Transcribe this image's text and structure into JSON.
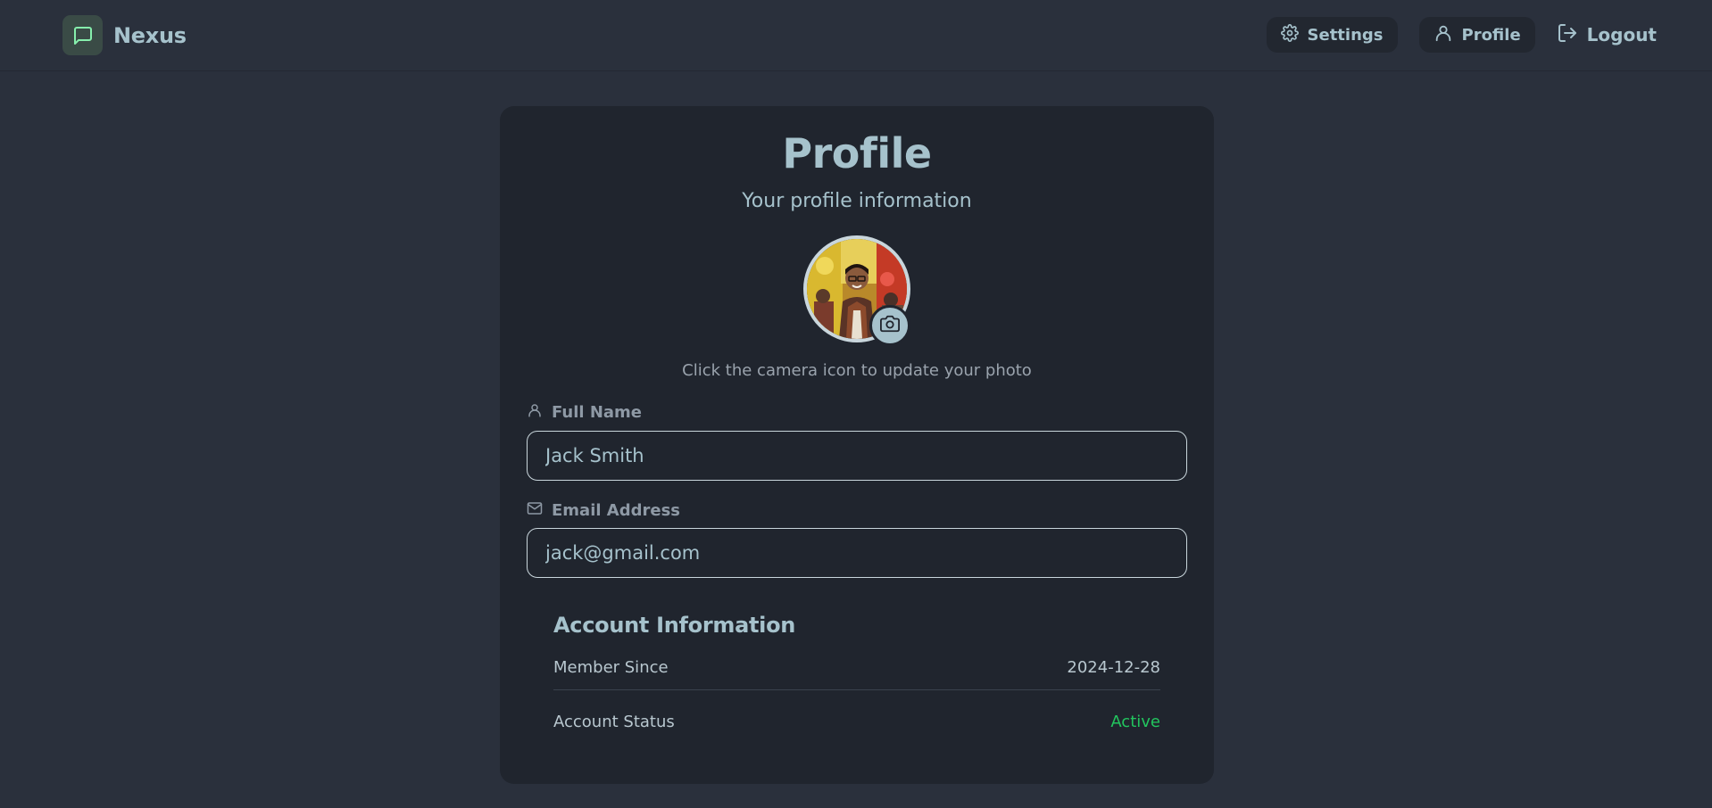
{
  "navbar": {
    "brand_name": "Nexus",
    "settings_label": "Settings",
    "profile_label": "Profile",
    "logout_label": "Logout"
  },
  "profile": {
    "title": "Profile",
    "subtitle": "Your profile information",
    "photo_hint": "Click the camera icon to update your photo",
    "full_name_label": "Full Name",
    "full_name_value": "Jack Smith",
    "email_label": "Email Address",
    "email_value": "jack@gmail.com"
  },
  "account": {
    "title": "Account Information",
    "member_since_label": "Member Since",
    "member_since_value": "2024-12-28",
    "status_label": "Account Status",
    "status_value": "Active"
  },
  "icons": {
    "brand": "chat-bubble-icon",
    "settings": "gear-icon",
    "profile": "user-icon",
    "logout": "logout-icon",
    "camera": "camera-icon",
    "full_name": "user-icon",
    "email": "mail-icon"
  },
  "colors": {
    "background": "#2a303c",
    "card": "#20252e",
    "accent": "#a6c2cc",
    "brand_green": "#86efac",
    "status_active": "#22c55e"
  }
}
